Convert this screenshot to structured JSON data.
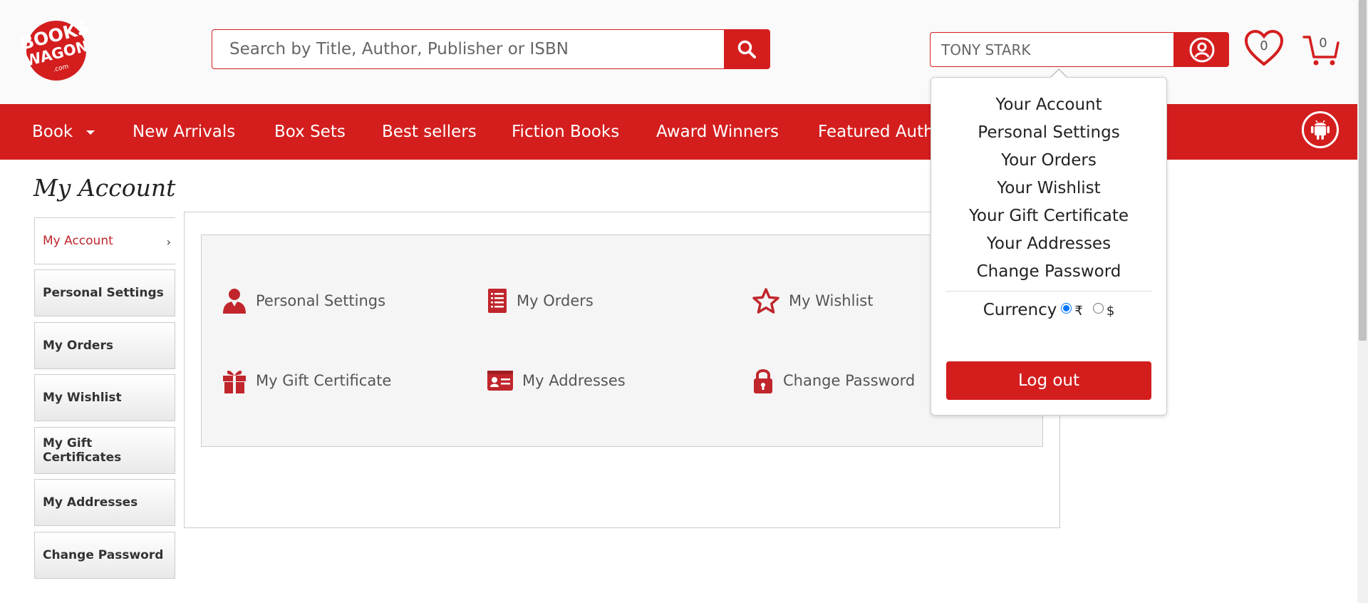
{
  "header": {
    "logo": {
      "line1": "BOOKS",
      "line2": "WAGON",
      "line3": ".com"
    },
    "search": {
      "placeholder": "Search by Title, Author, Publisher or ISBN",
      "value": ""
    },
    "user": {
      "name": "TONY STARK"
    },
    "wishlist_count": "0",
    "cart_count": "0"
  },
  "nav": {
    "items": [
      {
        "label": "Book"
      },
      {
        "label": "New Arrivals"
      },
      {
        "label": "Box Sets"
      },
      {
        "label": "Best sellers"
      },
      {
        "label": "Fiction Books"
      },
      {
        "label": "Award Winners"
      },
      {
        "label": "Featured Authors"
      }
    ]
  },
  "page": {
    "title": "My Account"
  },
  "sidebar": {
    "items": [
      {
        "label": "My Account"
      },
      {
        "label": "Personal Settings"
      },
      {
        "label": "My Orders"
      },
      {
        "label": "My Wishlist"
      },
      {
        "label": "My Gift Certificates"
      },
      {
        "label": "My Addresses"
      },
      {
        "label": "Change Password"
      }
    ]
  },
  "tiles": [
    {
      "label": "Personal Settings",
      "icon": "user-icon"
    },
    {
      "label": "My Orders",
      "icon": "document-icon"
    },
    {
      "label": "My Wishlist",
      "icon": "star-icon"
    },
    {
      "label": "My Gift Certificate",
      "icon": "gift-icon"
    },
    {
      "label": "My Addresses",
      "icon": "id-card-icon"
    },
    {
      "label": "Change Password",
      "icon": "lock-icon"
    }
  ],
  "dropdown": {
    "items": [
      {
        "label": "Your Account"
      },
      {
        "label": "Personal Settings"
      },
      {
        "label": "Your Orders"
      },
      {
        "label": "Your Wishlist"
      },
      {
        "label": "Your Gift Certificate"
      },
      {
        "label": "Your Addresses"
      },
      {
        "label": "Change Password"
      }
    ],
    "currency_label": "Currency",
    "currency_options": [
      "₹",
      "$"
    ],
    "currency_selected": "₹",
    "logout": "Log out"
  },
  "colors": {
    "brand_red": "#d41e1e",
    "icon_red": "#c0262c"
  }
}
